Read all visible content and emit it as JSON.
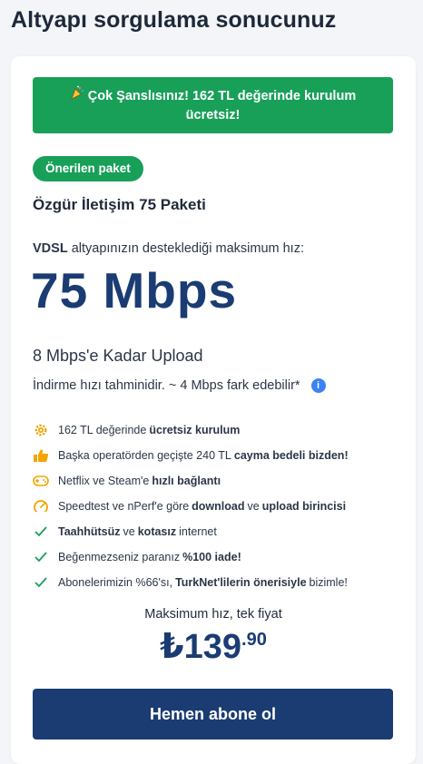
{
  "page_title": "Altyapı sorgulama sonucunuz",
  "promo": {
    "icon": "party-popper-icon",
    "text": "Çok Şanslısınız! 162 TL değerinde kurulum ücretsiz!"
  },
  "badge": "Önerilen paket",
  "package_name": "Özgür İletişim 75 Paketi",
  "speed_intro": {
    "tech": "VDSL",
    "text": "altyapınızın desteklediği maksimum hız:"
  },
  "speed": "75 Mbps",
  "upload": "8 Mbps'e Kadar Upload",
  "estimate": "İndirme hızı tahminidir. ~ 4 Mbps fark edebilir*",
  "features": [
    {
      "icon": "gear-icon",
      "pre": "162 TL değerinde",
      "bold": "ücretsiz kurulum",
      "post": ""
    },
    {
      "icon": "thumbs-up-icon",
      "pre": "Başka operatörden geçişte 240 TL",
      "bold": "cayma bedeli bizden!",
      "post": ""
    },
    {
      "icon": "gamepad-icon",
      "pre": "Netflix ve Steam'e",
      "bold": "hızlı bağlantı",
      "post": ""
    },
    {
      "icon": "speedometer-icon",
      "pre": "Speedtest ve nPerf'e göre",
      "bold": "download",
      "mid": "ve",
      "bold2": "upload birincisi",
      "post": ""
    },
    {
      "icon": "check-icon",
      "pre": "",
      "bold": "Taahhütsüz",
      "mid": "ve",
      "bold2": "kotasız",
      "post": "internet"
    },
    {
      "icon": "check-icon",
      "pre": "Beğenmezseniz paranız",
      "bold": "%100 iade!",
      "post": ""
    },
    {
      "icon": "check-icon",
      "pre": "Abonelerimizin %66'sı,",
      "bold": "TurkNet'lilerin önerisiyle",
      "post": "bizimle!"
    }
  ],
  "price_caption": "Maksimum hız, tek fiyat",
  "price": {
    "currency": "₺",
    "main": "139",
    "cents": ".90"
  },
  "subscribe_label": "Hemen abone ol",
  "colors": {
    "accent_green": "#18a058",
    "brand_navy": "#1a3c73",
    "info_blue": "#3b82f6",
    "icon_orange": "#f0a500"
  }
}
